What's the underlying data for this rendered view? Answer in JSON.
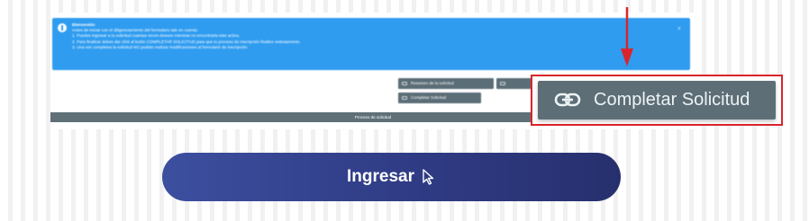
{
  "banner": {
    "title": "Bienvenido:",
    "lines": [
      "Antes de iniciar con el diligenciamiento del formulario tale en cuenta:",
      "1. Puedes ingresar a tu solicitud cuantas veces desees mientras no encontrarla este activa.",
      "2. Para finalizar debes dar click al botón COMPLETAR SOLICITUD para que tu proceso de inscripción finalice exitosamente.",
      "3. Una vez completes la solicitud NO podrás realizar modificaciones al formulario de inscripción."
    ],
    "close": "×"
  },
  "actions": {
    "resumen_label": "Resumen de la solicitud",
    "completar_small_label": "Completar Solicitud"
  },
  "process_bar": {
    "label": "Proceso de solicitud"
  },
  "zoom": {
    "button_label": "Completar Solicitud"
  },
  "login": {
    "button_label": "Ingresar"
  },
  "colors": {
    "banner": "#2f9cf0",
    "button_gray": "#5d6e76",
    "highlight_red": "#d9252b",
    "primary_blue": "#2f3b84"
  }
}
